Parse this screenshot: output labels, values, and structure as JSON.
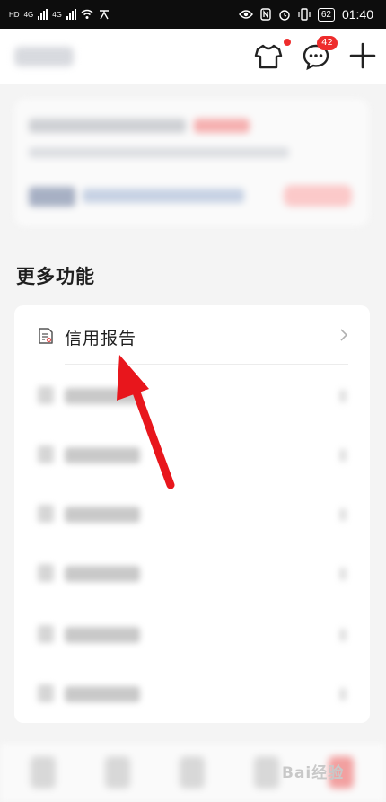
{
  "status_bar": {
    "left_labels": [
      "HD",
      "4G",
      "4G"
    ],
    "right_icons": [
      "eye-icon",
      "nfc-icon",
      "alarm-icon",
      "vibrate-icon"
    ],
    "battery": "62",
    "time": "01:40"
  },
  "header": {
    "message_badge": "42",
    "icons": [
      "shirt-icon",
      "message-icon",
      "plus-icon"
    ]
  },
  "more_functions": {
    "title": "更多功能",
    "items": [
      {
        "label": "信用报告",
        "icon": "document-icon"
      }
    ]
  },
  "colors": {
    "accent_red": "#ee2c2c",
    "annotation_arrow": "#e8161c"
  },
  "watermark": "Bai经验"
}
